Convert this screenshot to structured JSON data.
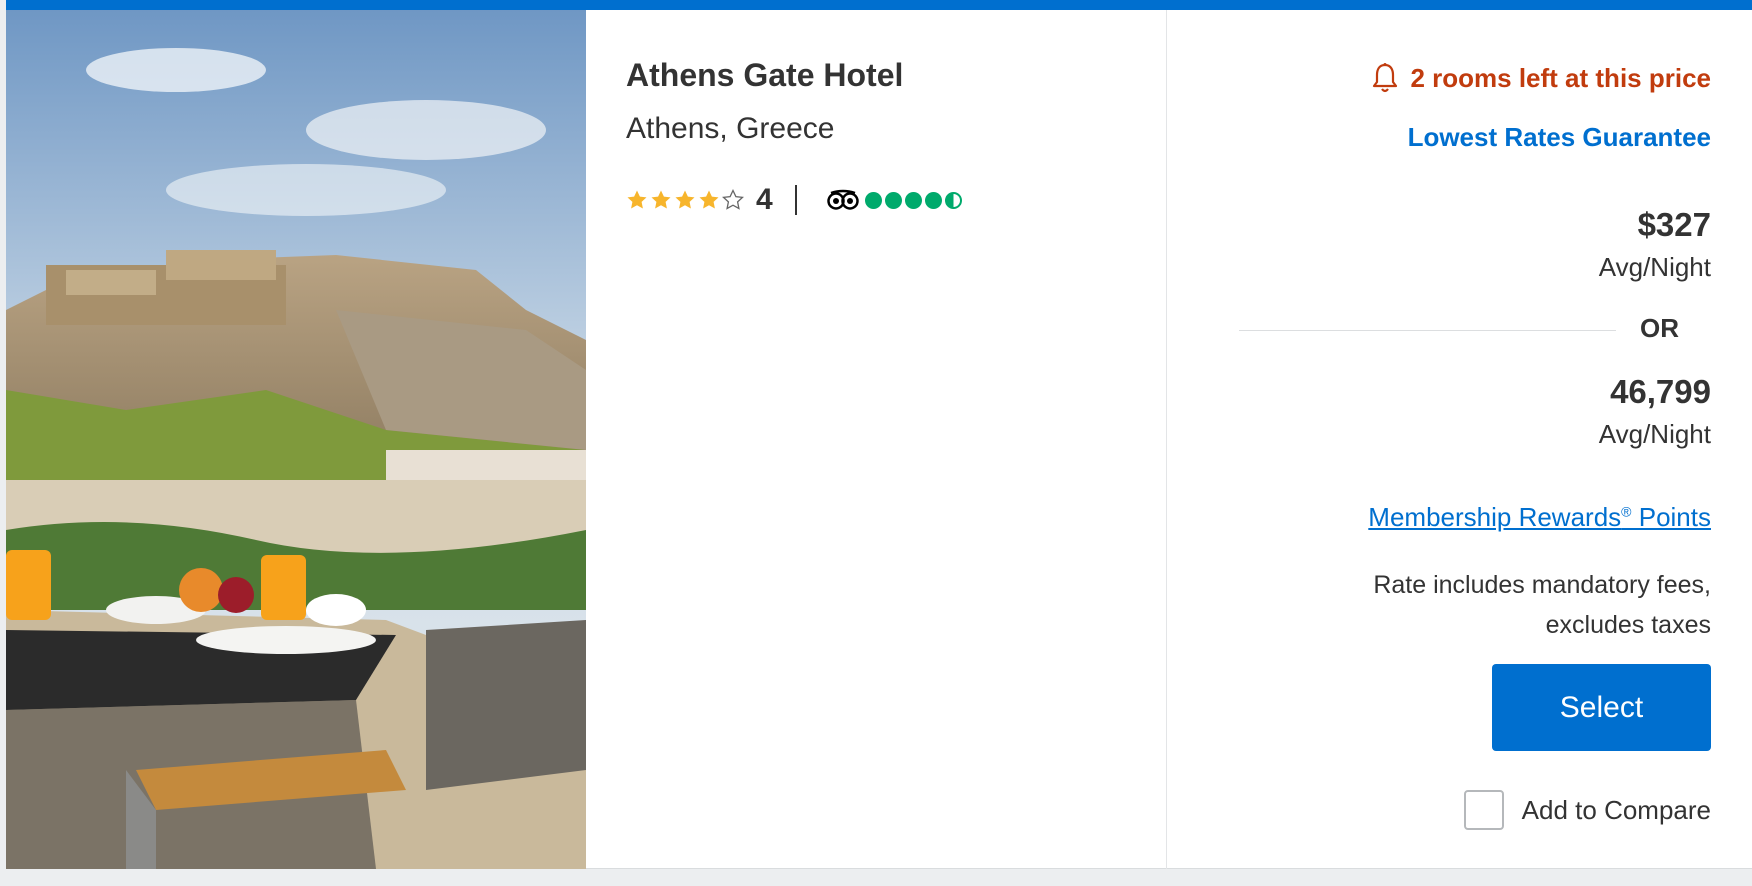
{
  "hotel": {
    "name": "Athens Gate Hotel",
    "location": "Athens, Greece",
    "star_rating": 4,
    "star_rating_label": "4",
    "star_max": 5,
    "tripadvisor_bubbles": 4.5,
    "tripadvisor_icon": "tripadvisor-owl-icon",
    "photo_icon": "hotel-photo-acropolis"
  },
  "pricing": {
    "availability_alert": "2 rooms left at this price",
    "alert_icon": "bell-icon",
    "guarantee_link": "Lowest Rates Guarantee",
    "cash_price": "$327",
    "cash_unit": "Avg/Night",
    "or_label": "OR",
    "points_price": "46,799",
    "points_unit": "Avg/Night",
    "rewards_link": "Membership Rewards",
    "rewards_link_mark": "®",
    "rewards_link_suffix": " Points",
    "fees_line1": "Rate includes mandatory fees,",
    "fees_line2": "excludes taxes",
    "select_label": "Select",
    "compare_label": "Add to Compare",
    "compare_checked": false
  },
  "colors": {
    "brand_blue": "#006fcf",
    "alert_red": "#c13c0e",
    "star_gold": "#f7b52c",
    "tripadvisor_green": "#00aa6c"
  }
}
